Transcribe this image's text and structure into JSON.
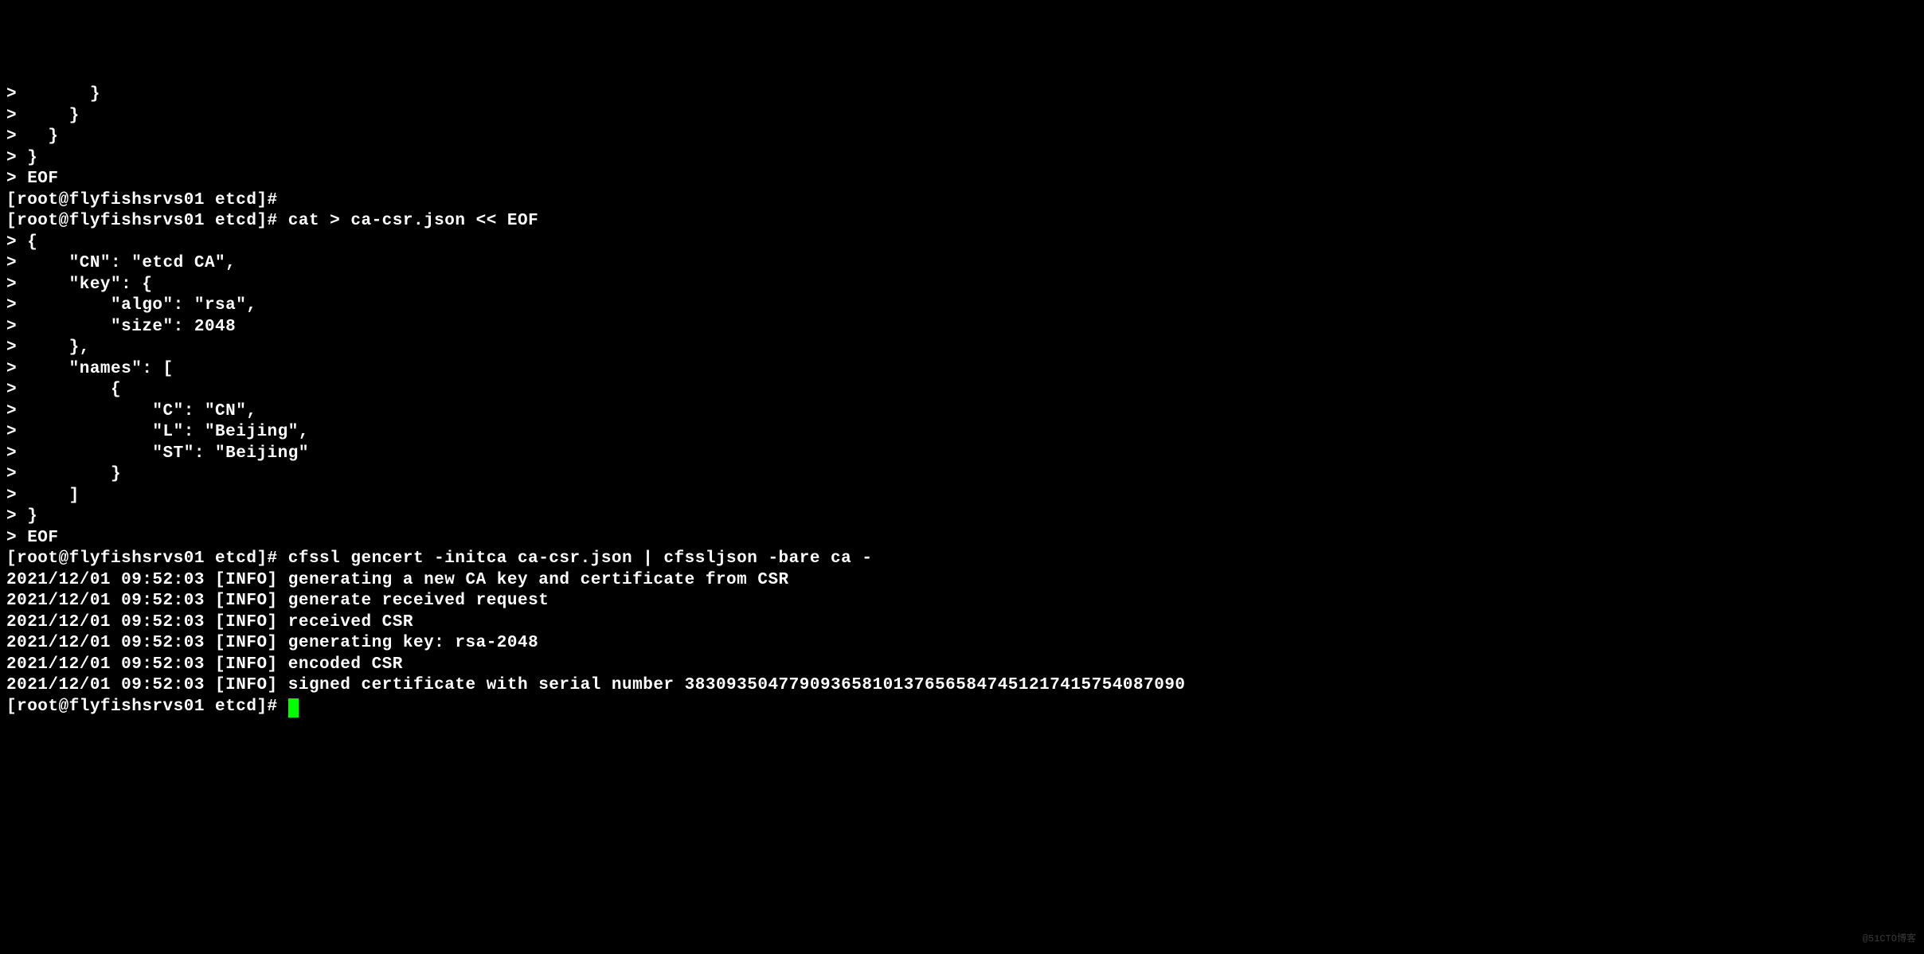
{
  "lines": [
    ">       }",
    ">     }",
    ">   }",
    "> }",
    "> EOF",
    "[root@flyfishsrvs01 etcd]#",
    "[root@flyfishsrvs01 etcd]# cat > ca-csr.json << EOF",
    "> {",
    ">     \"CN\": \"etcd CA\",",
    ">     \"key\": {",
    ">         \"algo\": \"rsa\",",
    ">         \"size\": 2048",
    ">     },",
    ">     \"names\": [",
    ">         {",
    ">             \"C\": \"CN\",",
    ">             \"L\": \"Beijing\",",
    ">             \"ST\": \"Beijing\"",
    ">         }",
    ">     ]",
    "> }",
    "> EOF",
    "[root@flyfishsrvs01 etcd]# cfssl gencert -initca ca-csr.json | cfssljson -bare ca -",
    "2021/12/01 09:52:03 [INFO] generating a new CA key and certificate from CSR",
    "2021/12/01 09:52:03 [INFO] generate received request",
    "2021/12/01 09:52:03 [INFO] received CSR",
    "2021/12/01 09:52:03 [INFO] generating key: rsa-2048",
    "2021/12/01 09:52:03 [INFO] encoded CSR",
    "2021/12/01 09:52:03 [INFO] signed certificate with serial number 383093504779093658101376565847451217415754087090"
  ],
  "prompt_final": "[root@flyfishsrvs01 etcd]# ",
  "watermark": "@51CTO博客"
}
